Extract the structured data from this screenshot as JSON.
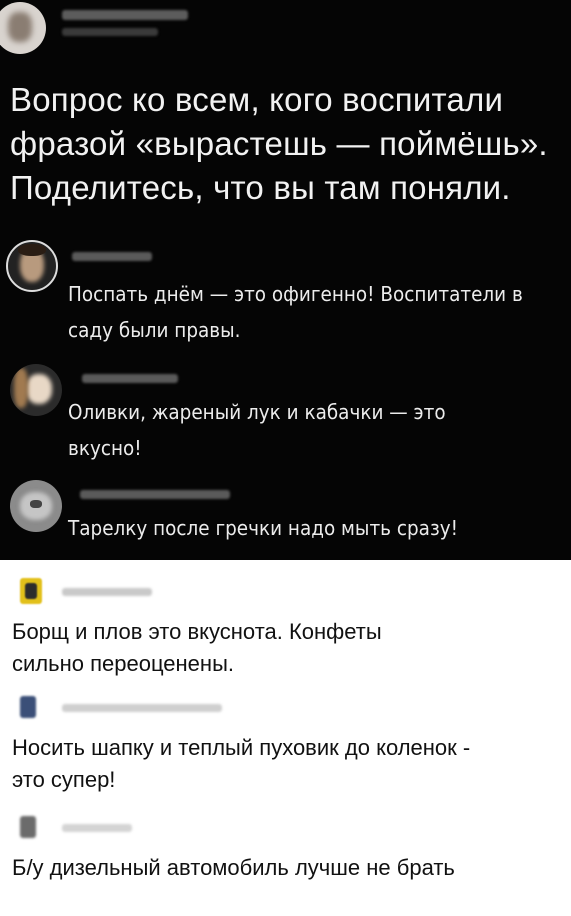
{
  "post": {
    "text": "Вопрос ко всем, кого воспитали фразой «вырастешь — поймёшь». Поделитесь, что вы там поняли."
  },
  "dark_comments": [
    {
      "text": "Поспать днём — это офигенно! Воспитатели в саду были правы."
    },
    {
      "text": "Оливки, жареный лук и кабачки — это вкусно!"
    },
    {
      "text": "Тарелку после гречки надо мыть сразу!"
    }
  ],
  "light_comments": [
    {
      "text": "Борщ и плов это вкуснота. Конфеты сильно переоценены."
    },
    {
      "text": "Носить шапку и теплый пуховик до коленок - это супер!"
    },
    {
      "text": "Б/у дизельный автомобиль лучше не брать"
    }
  ],
  "colors": {
    "dark_bg": "#050505",
    "light_bg": "#ffffff",
    "dark_text": "#f2f2f2",
    "light_text": "#111111"
  }
}
